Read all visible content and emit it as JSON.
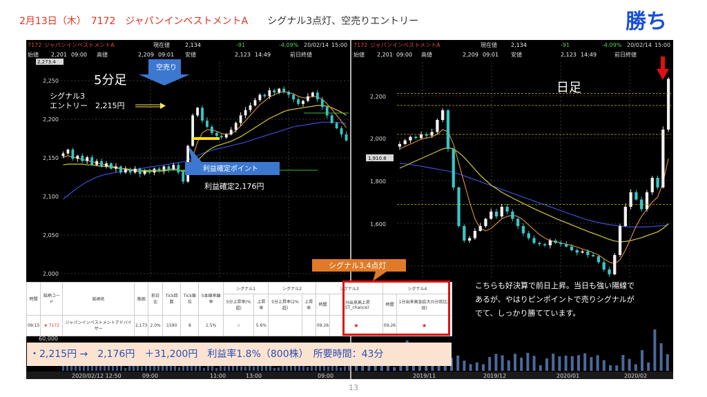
{
  "header": {
    "title": "2月13日（木）　7172　ジャパンインベストメントA",
    "signal": "シグナル3点灯、空売りエントリー",
    "result": "勝ち"
  },
  "left_panel": {
    "info": {
      "code": "7172",
      "name": "ジャパンインベストメントA",
      "current_label": "現在値",
      "current": "2,134",
      "change": "-91",
      "pct": "-4.09%",
      "date": "20/02/14",
      "time": "15:00",
      "open_label": "始値",
      "open": "2,201",
      "open_t": "09:00",
      "high_label": "高値",
      "high": "2,209",
      "high_t": "09:01",
      "low_label": "安値",
      "low": "2,123",
      "low_t": "14:49",
      "prev_label": "前日終値"
    },
    "top_price": "2,273.4",
    "title": "5分足",
    "sell_label": "空売り",
    "signal_label": "シグナル3",
    "entry_label": "エントリー　2,215円",
    "tp_label": "利益確定ポイント",
    "tp_value": "利益確定2,176円",
    "y_ticks": [
      "2,250",
      "2,200",
      "2,150",
      "2,100",
      "2,050",
      "2,000"
    ],
    "vol_label": "60,000",
    "x_labels": [
      "2020/02/12 12:50",
      "09:00",
      "11:00",
      "13:00",
      "09:00"
    ]
  },
  "right_panel": {
    "info": {
      "code": "7172",
      "name": "ジャパンインベストメントA",
      "current_label": "現在値",
      "current": "2,134",
      "change": "-91",
      "pct": "-4.09%",
      "date": "20/02/14",
      "time": "15:00",
      "open_label": "始値",
      "open": "2,201",
      "open_t": "09:00",
      "high_label": "高値",
      "high": "2,209",
      "high_t": "09:01",
      "low_label": "安値",
      "low": "2,123",
      "low_t": "14:49",
      "prev_label": "前日終値"
    },
    "title": "日足",
    "y_ticks": [
      "2,200",
      "2,000",
      "1,800",
      "1,600"
    ],
    "price_marker": "1,910.6",
    "comment": [
      "こちらも好決算で前日上昇。当日も強い陽線で",
      "あるが、やはりピンポイントで売りシグナルが",
      "でて、しっかり勝てています。"
    ],
    "x_labels": [
      "2019/11",
      "2019/12",
      "2020/01",
      "2020/02"
    ]
  },
  "signal_callout": "シグナル3,4点灯",
  "table": {
    "headers": [
      "時間",
      "銘柄コード",
      "銘柄名",
      "株価",
      "前日比",
      "Tick回数",
      "Tick順位",
      "5本線乖離率"
    ],
    "sig_headers": [
      "シグナル1",
      "シグナル2",
      "シグナル3",
      "シグナル4"
    ],
    "sub_headers": [
      "5分上昇率(%超)",
      "上昇率",
      "5分上昇率(2%超)",
      "上昇率",
      "時間",
      "1分出来高上昇(ET_chance)",
      "時間",
      "1分出来高急拡大(5分前比2倍)"
    ],
    "row": [
      "09:15",
      "★ 7172",
      "ジャパンインベストメントアドバイザー",
      "2,173",
      "2.0%",
      "1590",
      "8",
      "1.5%",
      "☆",
      "5.6%",
      "",
      "",
      "09:26",
      "★",
      "09:26",
      "★"
    ]
  },
  "summary": "・2,215円 →　2,176円　＋31,200円　利益率1.8%（800株）　所要時間：43分",
  "page_number": "13",
  "chart_data": [
    {
      "type": "candlestick",
      "title": "5分足",
      "ylim": [
        1990,
        2275
      ],
      "y_ticks": [
        2000,
        2050,
        2100,
        2150,
        2200,
        2250
      ],
      "x_labels": [
        "2020/02/12 12:50",
        "09:00",
        "11:00",
        "13:00",
        "09:00"
      ],
      "close": [
        2155,
        2160,
        2148,
        2152,
        2145,
        2150,
        2140,
        2145,
        2138,
        2142,
        2135,
        2138,
        2130,
        2134,
        2130,
        2135,
        2128,
        2132,
        2130,
        2135,
        2132,
        2138,
        2134,
        2140,
        2130,
        2118,
        2165,
        2205,
        2215,
        2198,
        2190,
        2182,
        2178,
        2176,
        2180,
        2186,
        2195,
        2205,
        2212,
        2218,
        2225,
        2232,
        2230,
        2238,
        2235,
        2240,
        2236,
        2232,
        2226,
        2220,
        2224,
        2230,
        2235,
        2226,
        2216,
        2205,
        2195,
        2188,
        2180,
        2172
      ],
      "ma_short": [
        2150,
        2152,
        2150,
        2149,
        2147,
        2146,
        2144,
        2143,
        2141,
        2140,
        2138,
        2137,
        2135,
        2134,
        2133,
        2132,
        2131,
        2131,
        2131,
        2132,
        2132,
        2133,
        2134,
        2135,
        2134,
        2130,
        2135,
        2150,
        2170,
        2182,
        2186,
        2186,
        2184,
        2181,
        2180,
        2181,
        2185,
        2191,
        2198,
        2205,
        2212,
        2219,
        2224,
        2229,
        2232,
        2235,
        2236,
        2235,
        2233,
        2230,
        2228,
        2228,
        2230,
        2229,
        2226,
        2220,
        2213,
        2205,
        2197,
        2189
      ],
      "ma_mid": [
        2140,
        2141,
        2141,
        2141,
        2141,
        2140,
        2140,
        2139,
        2138,
        2138,
        2137,
        2136,
        2135,
        2135,
        2134,
        2133,
        2133,
        2132,
        2132,
        2132,
        2132,
        2132,
        2133,
        2133,
        2133,
        2132,
        2133,
        2138,
        2145,
        2152,
        2158,
        2162,
        2165,
        2167,
        2169,
        2171,
        2174,
        2177,
        2181,
        2185,
        2189,
        2193,
        2197,
        2201,
        2204,
        2207,
        2210,
        2212,
        2213,
        2214,
        2215,
        2216,
        2217,
        2218,
        2218,
        2217,
        2215,
        2212,
        2209,
        2205
      ],
      "ma_long": [
        2095,
        2100,
        2105,
        2110,
        2114,
        2118,
        2121,
        2124,
        2126,
        2128,
        2129,
        2130,
        2131,
        2132,
        2133,
        2134,
        2135,
        2136,
        2137,
        2138,
        2139,
        2140,
        2141,
        2142,
        2143,
        2144,
        2146,
        2149,
        2152,
        2155,
        2157,
        2159,
        2161,
        2162,
        2164,
        2165,
        2167,
        2168,
        2170,
        2172,
        2174,
        2176,
        2178,
        2180,
        2182,
        2184,
        2186,
        2188,
        2190,
        2191,
        2192,
        2193,
        2194,
        2195,
        2196,
        2196,
        2196,
        2196,
        2195,
        2194
      ],
      "entry": 2215,
      "take_profit": 2176
    },
    {
      "type": "candlestick",
      "title": "日足",
      "ylim": [
        1400,
        2300
      ],
      "y_ticks": [
        1600,
        1800,
        2000,
        2200
      ],
      "x_labels": [
        "2019/11",
        "2019/12",
        "2020/01",
        "2020/02"
      ],
      "close": [
        1960,
        1975,
        1990,
        1985,
        2000,
        1995,
        2010,
        2060,
        2100,
        1940,
        1780,
        1620,
        1560,
        1570,
        1600,
        1620,
        1650,
        1680,
        1660,
        1700,
        1680,
        1650,
        1620,
        1590,
        1570,
        1550,
        1545,
        1540,
        1560,
        1550,
        1545,
        1535,
        1520,
        1510,
        1515,
        1500,
        1495,
        1470,
        1440,
        1420,
        1500,
        1620,
        1700,
        1760,
        1730,
        1690,
        1760,
        1820,
        1780,
        2020,
        2230
      ],
      "ma_short": [
        1940,
        1950,
        1960,
        1970,
        1980,
        1985,
        1990,
        2000,
        2020,
        2010,
        1960,
        1880,
        1800,
        1720,
        1650,
        1610,
        1600,
        1610,
        1630,
        1650,
        1660,
        1665,
        1660,
        1645,
        1625,
        1605,
        1585,
        1570,
        1560,
        1555,
        1550,
        1545,
        1540,
        1533,
        1525,
        1518,
        1510,
        1500,
        1485,
        1470,
        1465,
        1480,
        1520,
        1570,
        1620,
        1660,
        1690,
        1720,
        1740,
        1800,
        1900
      ],
      "ma_mid": [
        1860,
        1870,
        1880,
        1890,
        1900,
        1910,
        1920,
        1930,
        1940,
        1945,
        1940,
        1925,
        1905,
        1880,
        1855,
        1830,
        1810,
        1790,
        1775,
        1760,
        1748,
        1736,
        1725,
        1714,
        1703,
        1692,
        1682,
        1672,
        1662,
        1652,
        1643,
        1634,
        1625,
        1616,
        1607,
        1598,
        1590,
        1582,
        1573,
        1565,
        1558,
        1555,
        1556,
        1560,
        1566,
        1572,
        1580,
        1588,
        1596,
        1610,
        1630
      ],
      "ma_long": [
        1880,
        1878,
        1875,
        1872,
        1868,
        1864,
        1860,
        1856,
        1852,
        1848,
        1842,
        1836,
        1828,
        1820,
        1812,
        1804,
        1796,
        1788,
        1780,
        1772,
        1764,
        1756,
        1748,
        1740,
        1732,
        1724,
        1716,
        1708,
        1700,
        1692,
        1684,
        1676,
        1668,
        1660,
        1652,
        1646,
        1640,
        1635,
        1630,
        1626,
        1623,
        1620,
        1618,
        1617,
        1616,
        1616,
        1617,
        1618,
        1620,
        1622,
        1625
      ],
      "reference_lines": [
        2170,
        2120,
        2000,
        1710
      ]
    }
  ]
}
